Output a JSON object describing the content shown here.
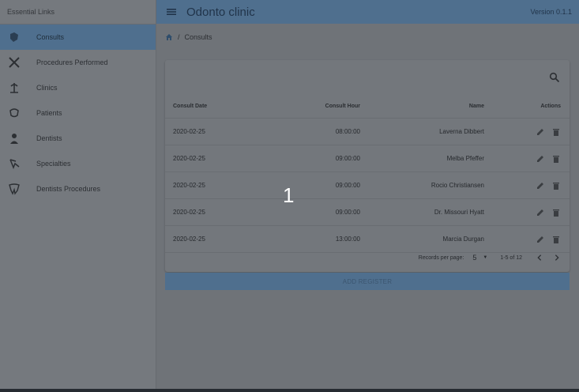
{
  "sidebar": {
    "header": "Essential Links",
    "items": [
      {
        "label": "Consults",
        "icon": "tooth-icon"
      },
      {
        "label": "Procedures Performed",
        "icon": "tools-icon"
      },
      {
        "label": "Clinics",
        "icon": "clinic-icon"
      },
      {
        "label": "Patients",
        "icon": "patient-icon"
      },
      {
        "label": "Dentists",
        "icon": "dentist-icon"
      },
      {
        "label": "Specialties",
        "icon": "specialty-icon"
      },
      {
        "label": "Dentists Procedures",
        "icon": "procedure-tooth-icon"
      }
    ]
  },
  "header": {
    "title": "Odonto clinic",
    "version": "Version 0.1.1"
  },
  "breadcrumb": {
    "current": "Consults",
    "separator": "/"
  },
  "table": {
    "columns": [
      "Consult Date",
      "Consult Hour",
      "Name",
      "Actions"
    ],
    "rows": [
      {
        "date": "2020-02-25",
        "hour": "08:00:00",
        "name": "Laverna Dibbert"
      },
      {
        "date": "2020-02-25",
        "hour": "09:00:00",
        "name": "Melba Pfeffer"
      },
      {
        "date": "2020-02-25",
        "hour": "09:00:00",
        "name": "Rocio Christiansen"
      },
      {
        "date": "2020-02-25",
        "hour": "09:00:00",
        "name": "Dr. Missouri Hyatt"
      },
      {
        "date": "2020-02-25",
        "hour": "13:00:00",
        "name": "Marcia Durgan"
      }
    ]
  },
  "pagination": {
    "records_label": "Records per page:",
    "records_value": "5",
    "range": "1-5 of 12"
  },
  "add_button": "ADD REGISTER",
  "overlay_number": "1",
  "colors": {
    "accent": "#4f6f8e",
    "background": "#6f7378",
    "card": "#73777c"
  }
}
